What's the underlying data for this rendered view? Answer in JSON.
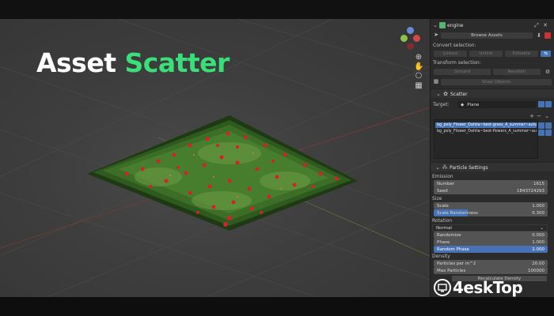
{
  "hero": {
    "word1": "Asset",
    "word2": "Scatter"
  },
  "panel": {
    "object_name": "engine",
    "browse_assets": "Browse Assets",
    "convert_selection": "Convert selection:",
    "convert_options": [
      "Linked",
      "Unlink",
      "Editable"
    ],
    "transform_selection": "Transform selection:",
    "transform_options": [
      "Ground",
      "Random"
    ],
    "snap_objects": "Snap Objects",
    "scatter_section": "Scatter",
    "target_label": "Target:",
    "target_value": "Plane",
    "list_items": [
      "bg_poly_Flower_Dahlia~best-grass_A_summer~autumn",
      "bg_poly_Flower_Dahlia~best-flowers_A_summer~autumn"
    ],
    "particle_section": "Particle Settings",
    "emission_label": "Emission",
    "number_label": "Number",
    "number_value": "1615",
    "seed_label": "Seed",
    "seed_value": "1843724293",
    "size_label": "Size",
    "scale_label": "Scale",
    "scale_value": "1.000",
    "scale_rand_label": "Scale Randomness",
    "scale_rand_value": "0.300",
    "rotation_label": "Rotation",
    "orientation_value": "Normal",
    "randomize_label": "Randomize",
    "randomize_value": "0.000",
    "phase_label": "Phase",
    "phase_value": "1.000",
    "random_phase_label": "Random Phase",
    "random_phase_value": "2.000",
    "density_label": "Density",
    "ppm_label": "Particles per m^2",
    "ppm_value": "20.00",
    "max_particles_label": "Max Particles",
    "max_particles_value": "100000",
    "recalc_label": "Recalculate Density"
  },
  "watermark": {
    "text": "4esk",
    "accent": "Top"
  }
}
